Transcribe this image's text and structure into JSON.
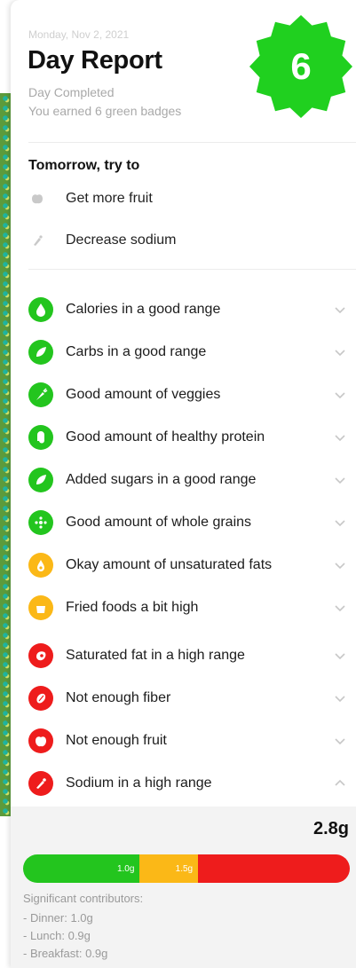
{
  "header": {
    "date": "Monday, Nov 2, 2021",
    "title": "Day Report",
    "status": "Day Completed",
    "earned": "You earned 6 green badges",
    "badge_count": "6",
    "badge_color": "#20d01f"
  },
  "tomorrow": {
    "heading": "Tomorrow, try to",
    "tips": [
      {
        "label": "Get more fruit",
        "icon": "apple-icon"
      },
      {
        "label": "Decrease sodium",
        "icon": "salt-shaker-icon"
      }
    ]
  },
  "colors": {
    "green": "#23c51e",
    "yellow": "#fbb817",
    "red": "#ee1c1c",
    "chevron": "#c7c7c7"
  },
  "rows": [
    {
      "label": "Calories in a good range",
      "status": "green",
      "icon": "flame-drop-icon"
    },
    {
      "label": "Carbs in a good range",
      "status": "green",
      "icon": "leaf-icon"
    },
    {
      "label": "Good amount of veggies",
      "status": "green",
      "icon": "carrot-icon"
    },
    {
      "label": "Good amount of healthy protein",
      "status": "green",
      "icon": "protein-icon"
    },
    {
      "label": "Added sugars in a good range",
      "status": "green",
      "icon": "leaf-icon"
    },
    {
      "label": "Good amount of whole grains",
      "status": "green",
      "icon": "grain-icon"
    },
    {
      "label": "Okay amount of unsaturated fats",
      "status": "yellow",
      "icon": "oil-drop-icon"
    },
    {
      "label": "Fried foods a bit high",
      "status": "yellow",
      "icon": "fries-icon"
    },
    {
      "label": "Saturated fat in a high range",
      "status": "red",
      "icon": "steak-icon"
    },
    {
      "label": "Not enough fiber",
      "status": "red",
      "icon": "bean-icon"
    },
    {
      "label": "Not enough fruit",
      "status": "red",
      "icon": "apple-icon"
    },
    {
      "label": "Sodium in a high range",
      "status": "red",
      "icon": "salt-shaker-icon",
      "expanded": true
    }
  ],
  "sodium_detail": {
    "amount": "2.8g",
    "bar": {
      "max_g": 2.8,
      "segments": [
        {
          "label": "1.0g",
          "limit_g": 1.0,
          "color": "#23c51e"
        },
        {
          "label": "1.5g",
          "limit_g": 1.5,
          "color": "#fbb817"
        },
        {
          "label": "",
          "limit_g": 2.8,
          "color": "#ee1c1c"
        }
      ]
    },
    "contributors_heading": "Significant contributors:",
    "contributors": [
      "- Dinner: 1.0g",
      "- Lunch: 0.9g",
      "- Breakfast: 0.9g"
    ]
  }
}
